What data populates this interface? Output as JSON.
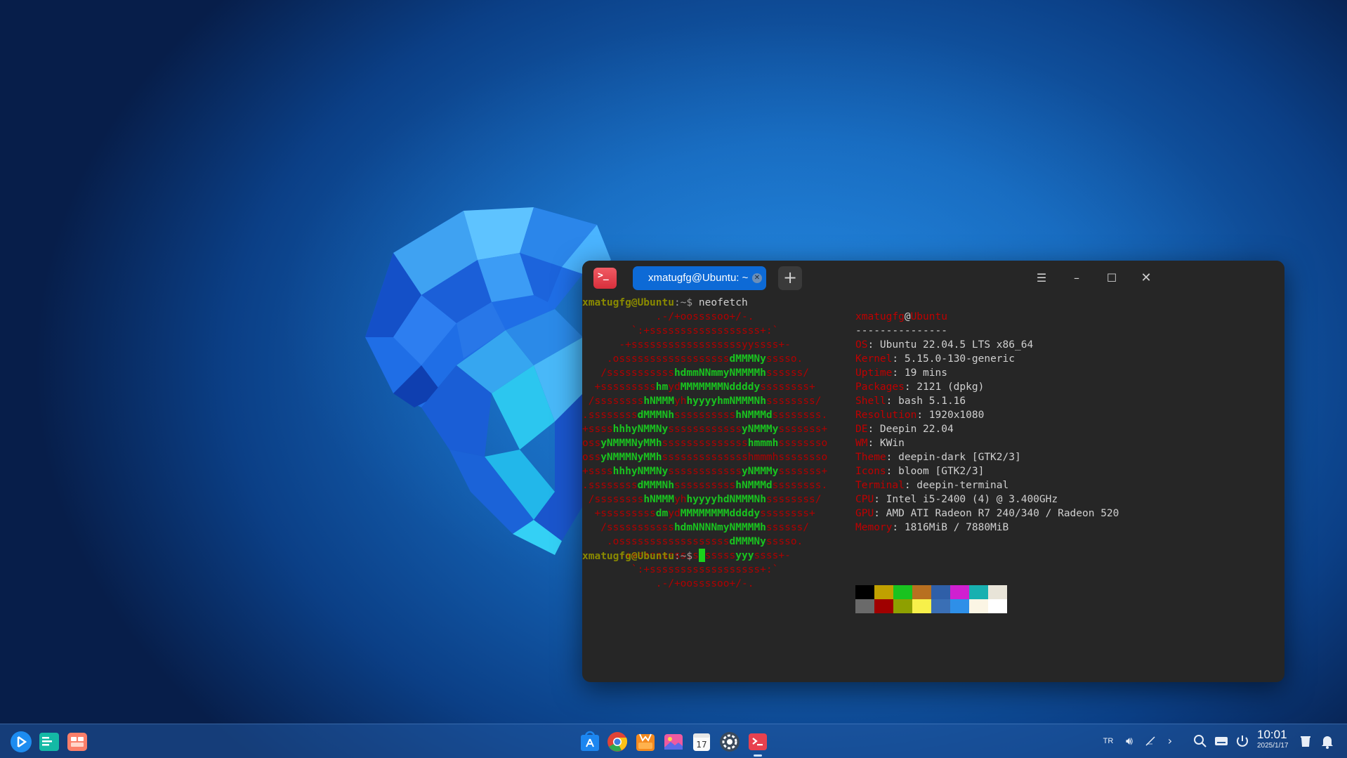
{
  "terminal": {
    "tab_title": "xmatugfg@Ubuntu: ~",
    "prompt_user": "xmatugfg@Ubuntu",
    "prompt_path": ":~$ ",
    "command": "neofetch",
    "logo_lines": [
      [
        {
          "t": "            .-/+oossssoo+/-.",
          "c": "r"
        }
      ],
      [
        {
          "t": "        `:+ssssssssssssssssss+:`",
          "c": "r"
        }
      ],
      [
        {
          "t": "      -+ssssssssssssssssssyyssss+-",
          "c": "r"
        }
      ],
      [
        {
          "t": "    .ossssssssssssssssss",
          "c": "r"
        },
        {
          "t": "dMMMNy",
          "c": "g"
        },
        {
          "t": "sssso.",
          "c": "r"
        }
      ],
      [
        {
          "t": "   /sssssssssss",
          "c": "r"
        },
        {
          "t": "hdmmNNmmyNMMMMh",
          "c": "g"
        },
        {
          "t": "ssssss/",
          "c": "r"
        }
      ],
      [
        {
          "t": "  +sssssssss",
          "c": "r"
        },
        {
          "t": "hm",
          "c": "g"
        },
        {
          "t": "yd",
          "c": "r"
        },
        {
          "t": "MMMMMMMNddddy",
          "c": "g"
        },
        {
          "t": "ssssssss+",
          "c": "r"
        }
      ],
      [
        {
          "t": " /ssssssss",
          "c": "r"
        },
        {
          "t": "hNMMM",
          "c": "g"
        },
        {
          "t": "yh",
          "c": "r"
        },
        {
          "t": "hyyyyhmNMMMNh",
          "c": "g"
        },
        {
          "t": "ssssssss/",
          "c": "r"
        }
      ],
      [
        {
          "t": ".ssssssss",
          "c": "r"
        },
        {
          "t": "dMMMNh",
          "c": "g"
        },
        {
          "t": "ssssssssss",
          "c": "r"
        },
        {
          "t": "hNMMMd",
          "c": "g"
        },
        {
          "t": "ssssssss.",
          "c": "r"
        }
      ],
      [
        {
          "t": "+ssss",
          "c": "r"
        },
        {
          "t": "hhhyNMMNy",
          "c": "g"
        },
        {
          "t": "ssssssssssss",
          "c": "r"
        },
        {
          "t": "yNMMMy",
          "c": "g"
        },
        {
          "t": "sssssss+",
          "c": "r"
        }
      ],
      [
        {
          "t": "oss",
          "c": "r"
        },
        {
          "t": "yNMMMNyMMh",
          "c": "g"
        },
        {
          "t": "ssssssssssssss",
          "c": "r"
        },
        {
          "t": "hmmmh",
          "c": "g"
        },
        {
          "t": "ssssssso",
          "c": "r"
        }
      ],
      [
        {
          "t": "oss",
          "c": "r"
        },
        {
          "t": "yNMMMNyMMh",
          "c": "g"
        },
        {
          "t": "sssssssssssssshmmmhssssssso",
          "c": "r"
        }
      ],
      [
        {
          "t": "+ssss",
          "c": "r"
        },
        {
          "t": "hhhyNMMNy",
          "c": "g"
        },
        {
          "t": "ssssssssssss",
          "c": "r"
        },
        {
          "t": "yNMMMy",
          "c": "g"
        },
        {
          "t": "sssssss+",
          "c": "r"
        }
      ],
      [
        {
          "t": ".ssssssss",
          "c": "r"
        },
        {
          "t": "dMMMNh",
          "c": "g"
        },
        {
          "t": "ssssssssss",
          "c": "r"
        },
        {
          "t": "hNMMMd",
          "c": "g"
        },
        {
          "t": "ssssssss.",
          "c": "r"
        }
      ],
      [
        {
          "t": " /ssssssss",
          "c": "r"
        },
        {
          "t": "hNMMM",
          "c": "g"
        },
        {
          "t": "yh",
          "c": "r"
        },
        {
          "t": "hyyyyhdNMMMNh",
          "c": "g"
        },
        {
          "t": "ssssssss/",
          "c": "r"
        }
      ],
      [
        {
          "t": "  +sssssssss",
          "c": "r"
        },
        {
          "t": "dm",
          "c": "g"
        },
        {
          "t": "yd",
          "c": "r"
        },
        {
          "t": "MMMMMMMMddddy",
          "c": "g"
        },
        {
          "t": "ssssssss+",
          "c": "r"
        }
      ],
      [
        {
          "t": "   /sssssssssss",
          "c": "r"
        },
        {
          "t": "hdmNNNNmyNMMMMh",
          "c": "g"
        },
        {
          "t": "ssssss/",
          "c": "r"
        }
      ],
      [
        {
          "t": "    .ossssssssssssssssss",
          "c": "r"
        },
        {
          "t": "dMMMNy",
          "c": "g"
        },
        {
          "t": "sssso.",
          "c": "r"
        }
      ],
      [
        {
          "t": "      -+sssssssssssssssss",
          "c": "r"
        },
        {
          "t": "yyy",
          "c": "g"
        },
        {
          "t": "ssss+-",
          "c": "r"
        }
      ],
      [
        {
          "t": "        `:+ssssssssssssssssss+:`",
          "c": "r"
        }
      ],
      [
        {
          "t": "            .-/+oossssoo+/-.",
          "c": "r"
        }
      ]
    ],
    "info_header": {
      "user": "xmatugfg",
      "at": "@",
      "host": "Ubuntu",
      "separator": "---------------"
    },
    "info": [
      {
        "k": "OS",
        "v": "Ubuntu 22.04.5 LTS x86_64"
      },
      {
        "k": "Kernel",
        "v": "5.15.0-130-generic"
      },
      {
        "k": "Uptime",
        "v": "19 mins"
      },
      {
        "k": "Packages",
        "v": "2121 (dpkg)"
      },
      {
        "k": "Shell",
        "v": "bash 5.1.16"
      },
      {
        "k": "Resolution",
        "v": "1920x1080"
      },
      {
        "k": "DE",
        "v": "Deepin 22.04"
      },
      {
        "k": "WM",
        "v": "KWin"
      },
      {
        "k": "Theme",
        "v": "deepin-dark [GTK2/3]"
      },
      {
        "k": "Icons",
        "v": "bloom [GTK2/3]"
      },
      {
        "k": "Terminal",
        "v": "deepin-terminal"
      },
      {
        "k": "CPU",
        "v": "Intel i5-2400 (4) @ 3.400GHz"
      },
      {
        "k": "GPU",
        "v": "AMD ATI Radeon R7 240/340 / Radeon 520"
      },
      {
        "k": "Memory",
        "v": "1816MiB / 7880MiB"
      }
    ],
    "palette_top": [
      "#000000",
      "#c0a000",
      "#19c31f",
      "#b87020",
      "#2f5fa8",
      "#d020d0",
      "#18b0b0",
      "#e8e4d8"
    ],
    "palette_bottom": [
      "#6a6a6a",
      "#a00000",
      "#8ea000",
      "#f7f04a",
      "#3a6fb5",
      "#2e8fe8",
      "#fbf5e4",
      "#ffffff"
    ]
  },
  "taskbar": {
    "keyboard_layout": "TR",
    "time": "10:01",
    "date": "2025/1/17"
  },
  "icons": {
    "launcher": "launcher-icon",
    "files": "file-manager-icon",
    "multitask": "multitask-view-icon",
    "store": "app-store-icon",
    "browser": "chrome-icon",
    "gift": "app-icon",
    "photos": "photos-icon",
    "calendar": "calendar-icon",
    "settings": "settings-icon",
    "terminal": "terminal-icon"
  }
}
